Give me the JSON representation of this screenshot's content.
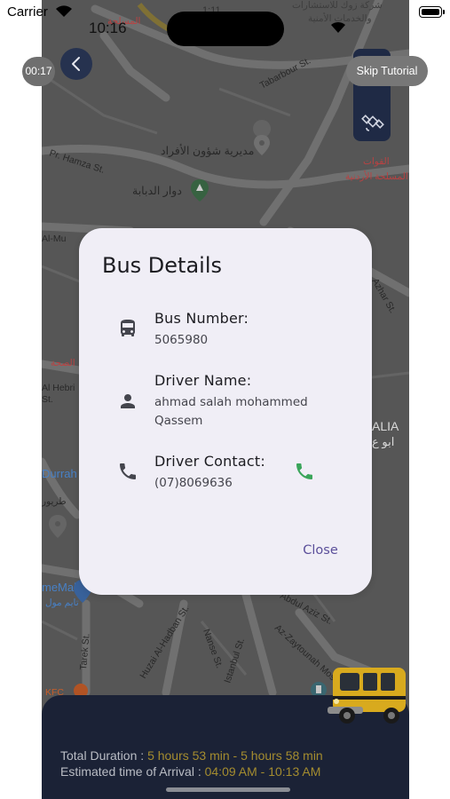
{
  "status_bar": {
    "carrier": "Carrier",
    "time": "10:16",
    "time_ghost": "1:11"
  },
  "map": {
    "labels": [
      "Tabarbour St.",
      "مديرية شؤون الأفراد",
      "دوار الدبابة",
      "Pr. Hamza St.",
      "Al Hebri",
      "St.",
      "Azhar St.",
      "Al-Mu",
      "ALIA",
      "ابو ع",
      "Durrah",
      "طريور",
      "meMall",
      "تايم مول",
      "Tarek St.",
      "Huzai Al-Hadban St.",
      "Nanse St.",
      "Istanbul St.",
      "Abdul Aziz St.",
      "Az-Zaytounah Mosque",
      "KFC",
      "القوات",
      "المسلحة الأردنية",
      "شركة زوك للاستشارات",
      "والخدمات الأمنية",
      "الصحة",
      "المسلحة"
    ]
  },
  "controls": {
    "timer": "00:17",
    "skip_tutorial": "Skip Tutorial"
  },
  "dialog": {
    "title": "Bus Details",
    "bus_number_label": "Bus Number:",
    "bus_number_value": "5065980",
    "driver_name_label": "Driver Name:",
    "driver_name_value": "ahmad salah mohammed Qassem",
    "driver_contact_label": "Driver Contact:",
    "driver_contact_value": "(07)8069636",
    "close_label": "Close"
  },
  "trip_info": {
    "total_duration_label": "Total Duration : ",
    "total_duration_value": "5 hours 53 min - 5 hours 58 min",
    "eta_label": "Estimated time of Arrival : ",
    "eta_value": "04:09 AM - 10:13 AM"
  },
  "colors": {
    "accent_dark": "#1b2236",
    "dialog_bg": "#f0eef6",
    "close_text": "#5b4f9a",
    "call_green": "#3aa55a",
    "info_value": "#a48c2f"
  },
  "icons": [
    "wifi-icon",
    "back-arrow-icon",
    "globe-icon",
    "satellite-icon",
    "bus-icon",
    "person-icon",
    "phone-icon",
    "call-icon",
    "location-pin-icon"
  ]
}
